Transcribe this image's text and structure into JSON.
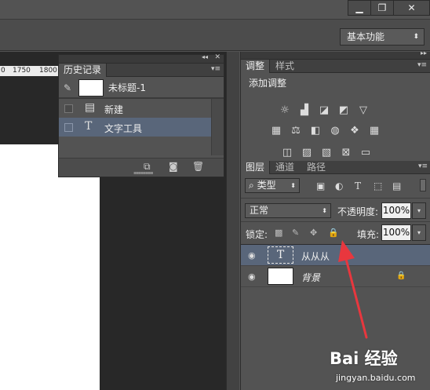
{
  "window": {
    "minimize_icon": "minimize-icon",
    "restore_icon": "restore-icon",
    "close_icon": "close-icon"
  },
  "options_bar": {
    "workspace": "基本功能"
  },
  "ruler": {
    "ticks": [
      "0",
      "1750",
      "1800"
    ]
  },
  "history_panel": {
    "tab": "历史记录",
    "snapshot_name": "未标题-1",
    "items": [
      {
        "label": "新建",
        "icon": "document-icon",
        "selected": false
      },
      {
        "label": "文字工具",
        "icon": "type-tool-icon",
        "selected": true
      }
    ],
    "footer_icons": [
      "new-document-from-state-icon",
      "camera-icon",
      "trash-icon"
    ]
  },
  "adjustments_panel": {
    "tabs": [
      "调整",
      "样式"
    ],
    "title": "添加调整",
    "icons_row1": [
      "brightness-icon",
      "levels-icon",
      "curves-icon",
      "exposure-icon",
      "vibrance-icon"
    ],
    "icons_row2": [
      "hue-saturation-icon",
      "color-balance-icon",
      "black-white-icon",
      "photo-filter-icon",
      "channel-mixer-icon",
      "color-lookup-icon"
    ],
    "icons_row3": [
      "invert-icon",
      "posterize-icon",
      "threshold-icon",
      "selective-color-icon",
      "gradient-map-icon"
    ]
  },
  "layers_panel": {
    "tabs": [
      "图层",
      "通道",
      "路径"
    ],
    "filter_kind": "类型",
    "blend_mode": "正常",
    "opacity_label": "不透明度:",
    "opacity": "100%",
    "lock_label": "锁定:",
    "fill_label": "填充:",
    "fill": "100%",
    "layers": [
      {
        "name": "从从从",
        "type": "text",
        "thumb_glyph": "T",
        "selected": true
      },
      {
        "name": "背景",
        "type": "background",
        "locked": true,
        "selected": false
      }
    ]
  },
  "watermark": {
    "logo": "Bai 经验",
    "url": "jingyan.baidu.com"
  },
  "colors": {
    "selection": "#59667a",
    "arrow": "#e8373e"
  }
}
